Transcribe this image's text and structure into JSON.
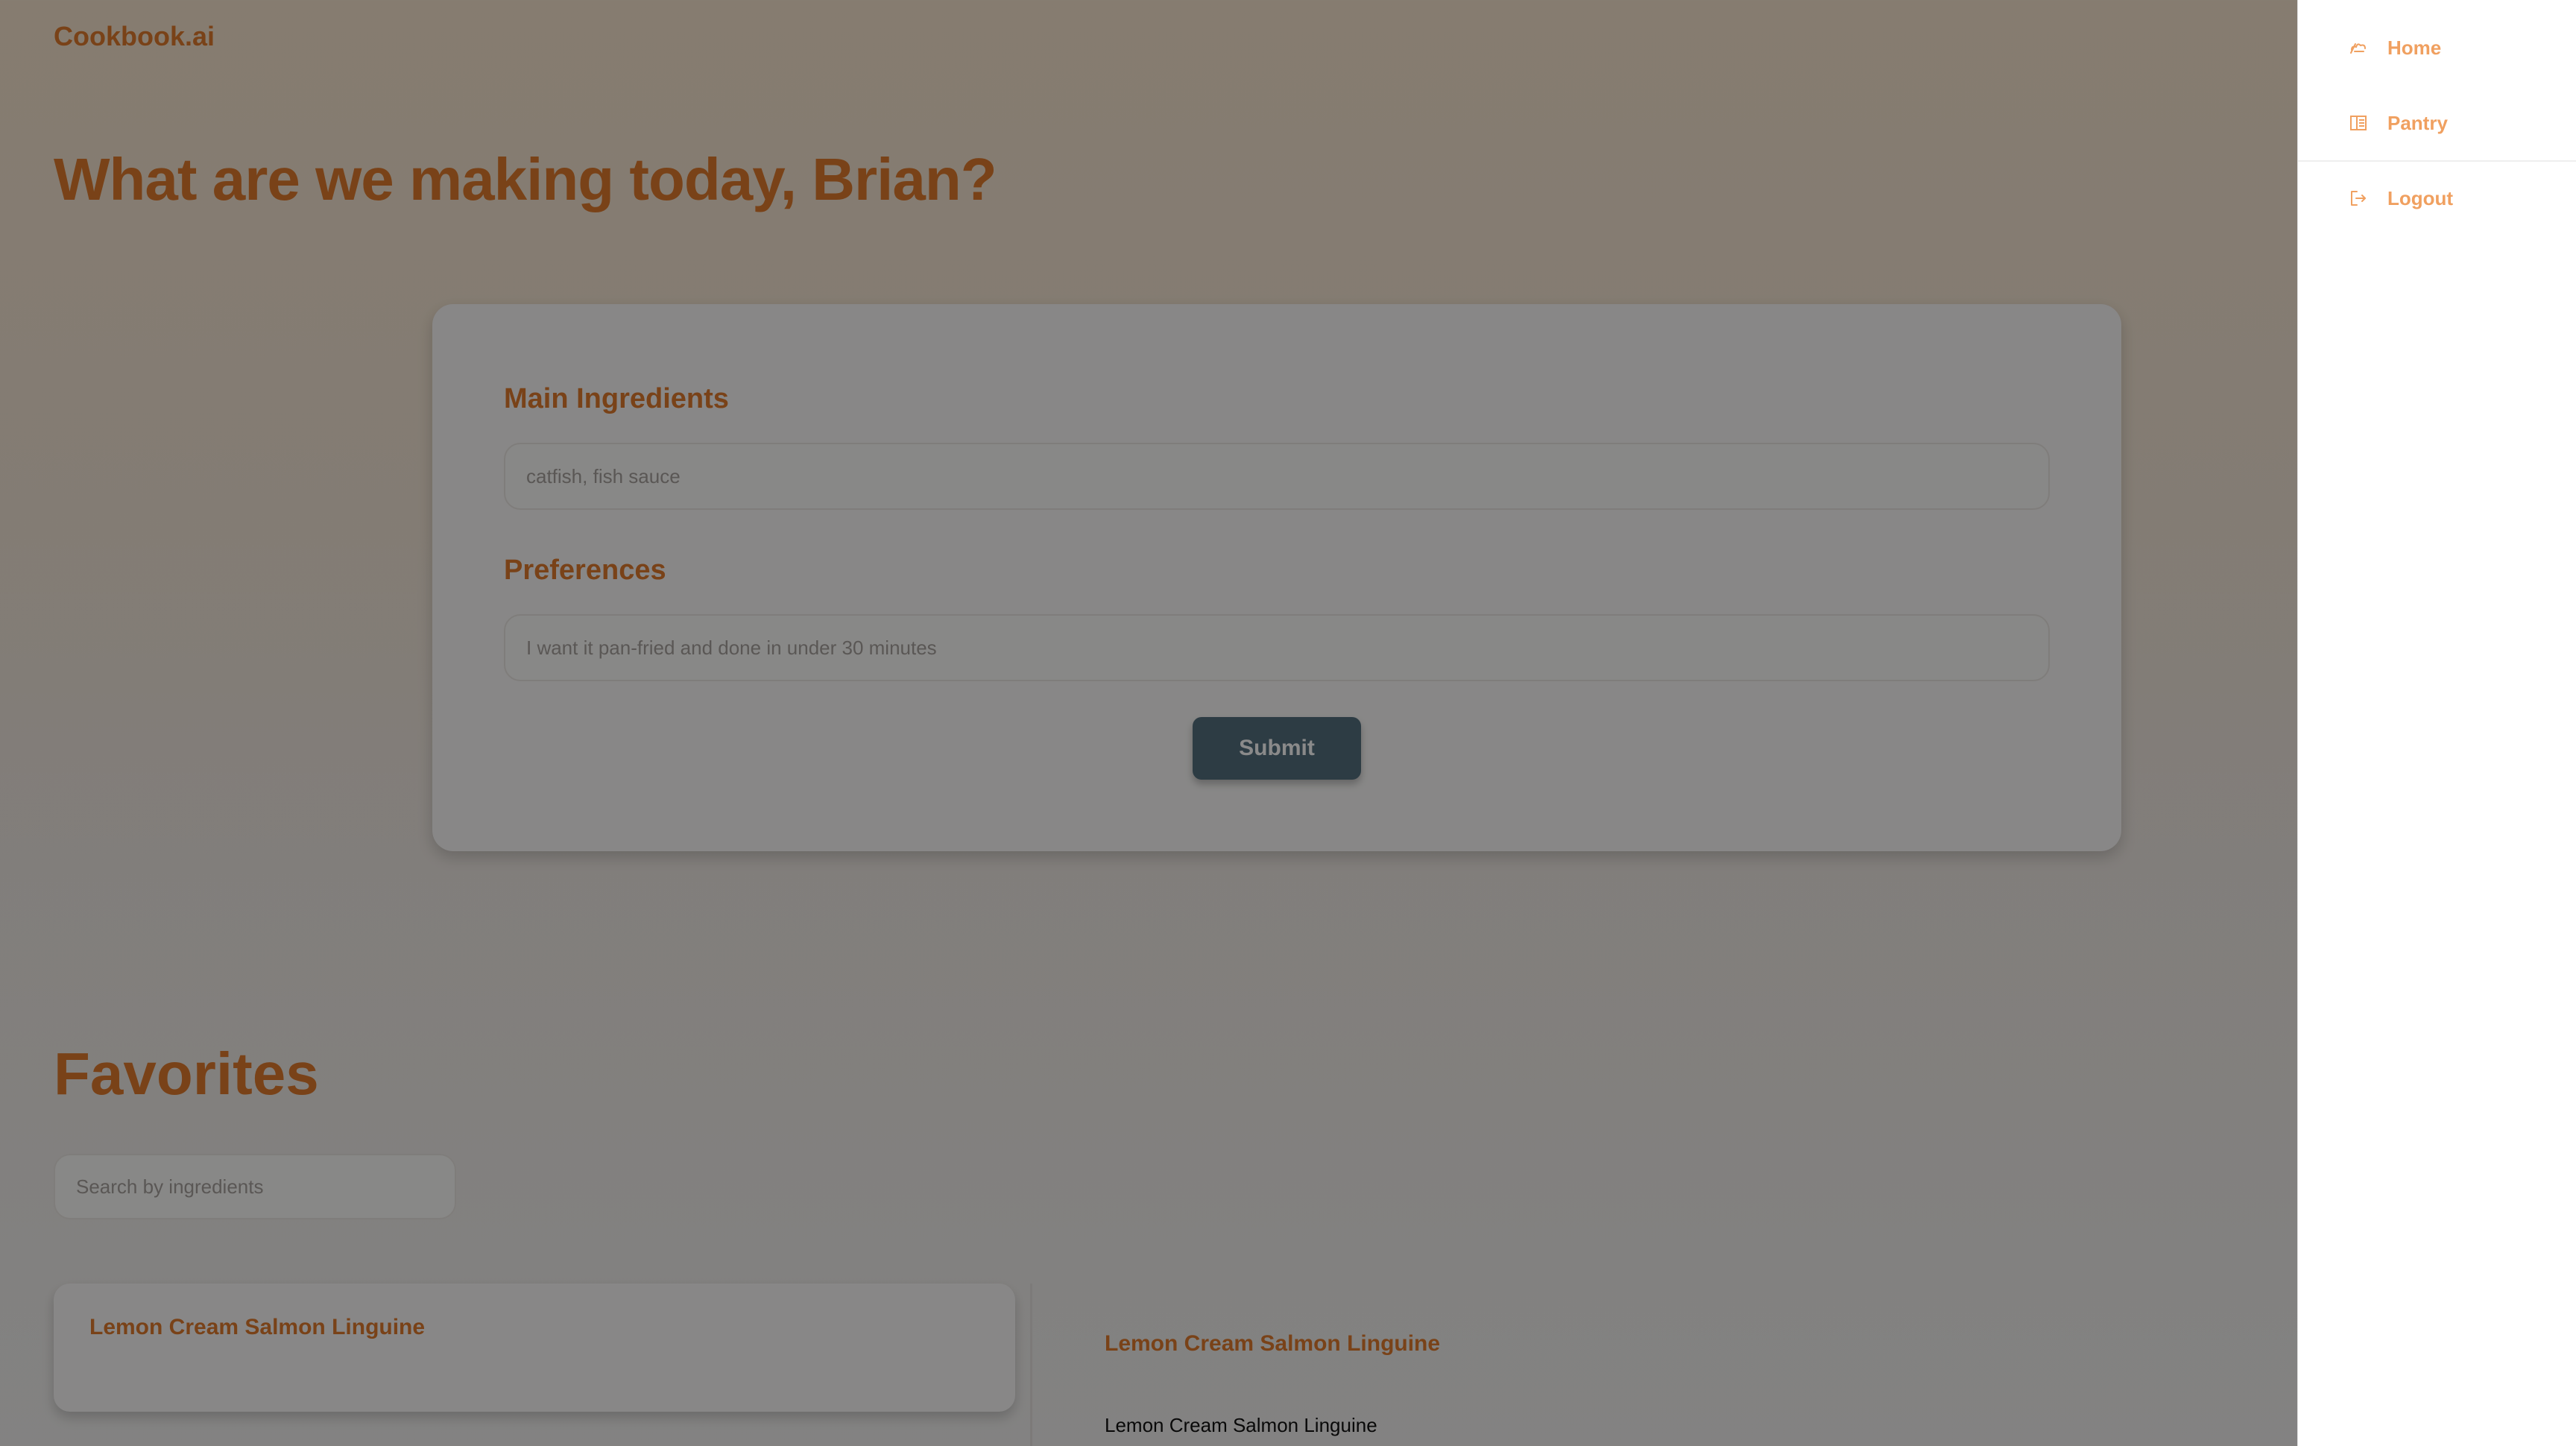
{
  "app": {
    "brand": "Cookbook.ai"
  },
  "hero": {
    "title": "What are we making today, Brian?"
  },
  "form": {
    "main_ingredients_label": "Main Ingredients",
    "main_ingredients_placeholder": "catfish, fish sauce",
    "preferences_label": "Preferences",
    "preferences_placeholder": "I want it pan-fried and done in under 30 minutes",
    "submit_label": "Submit"
  },
  "favorites": {
    "title": "Favorites",
    "search_placeholder": "Search by ingredients",
    "items": [
      {
        "title": "Lemon Cream Salmon Linguine"
      }
    ],
    "detail": {
      "title": "Lemon Cream Salmon Linguine",
      "subtitle": "Lemon Cream Salmon Linguine"
    }
  },
  "drawer": {
    "items": [
      {
        "label": "Home",
        "icon": "chef-hat-icon"
      },
      {
        "label": "Pantry",
        "icon": "pantry-icon"
      },
      {
        "label": "Logout",
        "icon": "logout-icon"
      }
    ]
  },
  "colors": {
    "accent": "#e07b2d",
    "drawer_text": "#f0a060",
    "submit": "#54707f"
  }
}
